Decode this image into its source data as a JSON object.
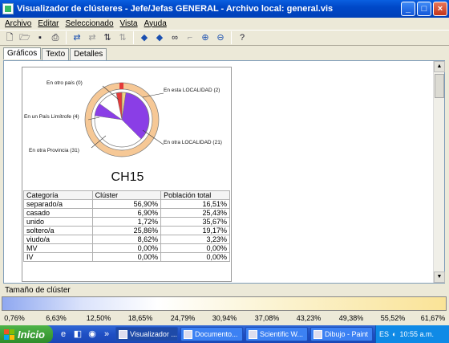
{
  "window": {
    "title": "Visualizador de clústeres - Jefe/Jefas GENERAL - Archivo local: general.vis"
  },
  "menu": [
    "Archivo",
    "Editar",
    "Seleccionado",
    "Vista",
    "Ayuda"
  ],
  "toolbar": {
    "icons": [
      "new-icon",
      "open-icon",
      "save-icon",
      "print-icon",
      "swap-icon",
      "swap-dim-icon",
      "sort-icon",
      "sort-dim-icon",
      "arrow-left-icon",
      "arrow-right-icon",
      "binoculars-icon",
      "select-icon",
      "zoom-in-icon",
      "zoom-out-icon",
      "help-icon"
    ]
  },
  "tabs": [
    "Gráficos",
    "Texto",
    "Detalles"
  ],
  "cluster": {
    "name": "CH15",
    "callouts": {
      "otro_pais": "En otro país (0)",
      "esta_localidad": "En esta LOCALIDAD (2)",
      "pais_limitrofe": "En un País Limítrofe (4)",
      "otra_localidad": "En otra LOCALIDAD (21)",
      "otra_provincia": "En otra Provincia (31)"
    }
  },
  "table": {
    "headers": [
      "Categoría",
      "Clúster",
      "Población total"
    ],
    "rows": [
      [
        "separado/a",
        "56,90%",
        "16,51%"
      ],
      [
        "casado",
        "6,90%",
        "25,43%"
      ],
      [
        "unido",
        "1,72%",
        "35,67%"
      ],
      [
        "soltero/a",
        "25,86%",
        "19,17%"
      ],
      [
        "viudo/a",
        "8,62%",
        "3,23%"
      ],
      [
        "MV",
        "0,00%",
        "0,00%"
      ],
      [
        "IV",
        "0,00%",
        "0,00%"
      ]
    ]
  },
  "size_legend": {
    "label": "Tamaño de clúster",
    "ticks": [
      "0,76%",
      "6,63%",
      "12,50%",
      "18,65%",
      "24,79%",
      "30,94%",
      "37,08%",
      "43,23%",
      "49,38%",
      "55,52%",
      "61,67%"
    ]
  },
  "taskbar": {
    "start": "Inicio",
    "tasks": [
      "Visualizador ...",
      "Documento...",
      "Scientific W...",
      "Dibujo - Paint"
    ],
    "lang": "ES",
    "clock": "10:55 a.m."
  }
}
